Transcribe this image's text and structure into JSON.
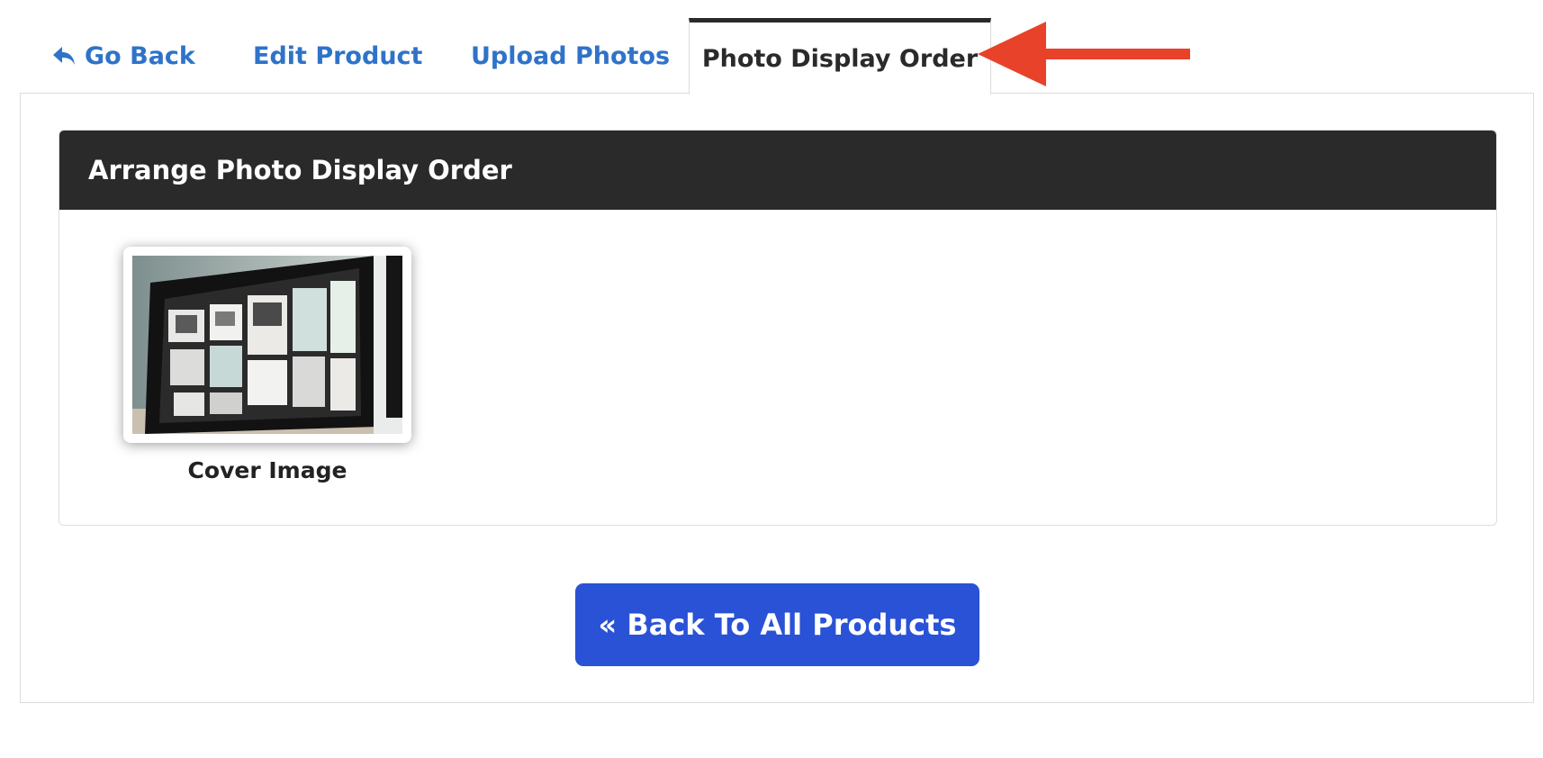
{
  "tabs": {
    "go_back": "Go Back",
    "edit_product": "Edit Product",
    "upload_photos": "Upload Photos",
    "photo_display_order": "Photo Display Order"
  },
  "arrange": {
    "title": "Arrange Photo Display Order",
    "photos": [
      {
        "caption": "Cover Image",
        "image": "monitor-photo"
      }
    ]
  },
  "back_button_label": "« Back To All Products",
  "colors": {
    "link": "#2f73c9",
    "header_bg": "#2a2a2a",
    "button_bg": "#2a52d6",
    "annotation_arrow": "#e8432a"
  },
  "icons": {
    "go_back": "reply-arrow-icon",
    "annotation": "red-arrow-icon"
  }
}
